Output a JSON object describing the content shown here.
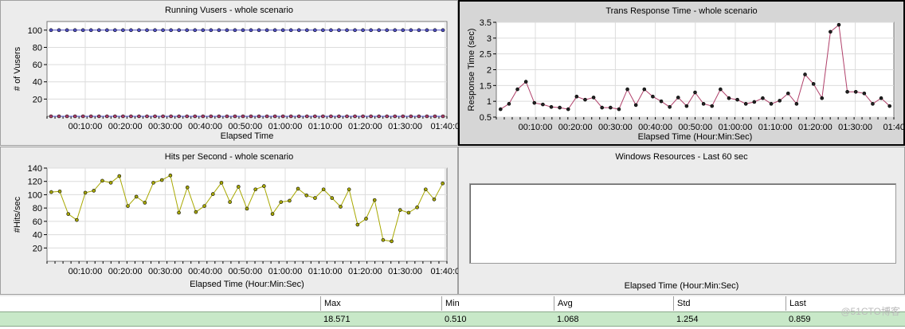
{
  "panels": {
    "vusers": {
      "title": "Running Vusers - whole scenario",
      "xlabel": "Elapsed Time",
      "ylabel": "# of Vusers"
    },
    "trans": {
      "title": "Trans Response Time - whole scenario",
      "xlabel": "Elapsed Time (Hour:Min:Sec)",
      "ylabel": "Response Time (sec)"
    },
    "hits": {
      "title": "Hits per Second - whole scenario",
      "xlabel": "Elapsed Time (Hour:Min:Sec)",
      "ylabel": "#Hits/sec"
    },
    "windows": {
      "title": "Windows Resources - Last 60 sec",
      "xlabel": "Elapsed Time (Hour:Min:Sec)"
    }
  },
  "colors": {
    "vusers": "#5050c8",
    "trans": "#b0406a",
    "hits": "#a8a800",
    "marker_green": "#2e7d32"
  },
  "chart_data": [
    {
      "type": "line",
      "title": "Running Vusers - whole scenario",
      "xlabel": "Elapsed Time",
      "ylabel": "# of Vusers",
      "x_tick_labels": [
        "00:10:00",
        "00:20:00",
        "00:30:00",
        "00:40:00",
        "00:50:00",
        "01:00:00",
        "01:10:00",
        "01:20:00",
        "01:30:00",
        "01:40:0"
      ],
      "y_ticks": [
        20,
        40,
        60,
        80,
        100
      ],
      "ylim": [
        0,
        110
      ],
      "series": [
        {
          "values": [
            100,
            100,
            100,
            100,
            100,
            100,
            100,
            100,
            100,
            100,
            100,
            100,
            100,
            100,
            100,
            100,
            100,
            100,
            100,
            100,
            100,
            100,
            100,
            100,
            100,
            100,
            100,
            100,
            100,
            100,
            100,
            100,
            100,
            100,
            100,
            100,
            100,
            100,
            100,
            100,
            100,
            100,
            100,
            100,
            100,
            100,
            100,
            100,
            100,
            100
          ]
        },
        {
          "values": [
            0,
            0,
            0,
            0,
            0,
            0,
            0,
            0,
            0,
            0,
            0,
            0,
            0,
            0,
            0,
            0,
            0,
            0,
            0,
            0,
            0,
            0,
            0,
            0,
            0,
            0,
            0,
            0,
            0,
            0,
            0,
            0,
            0,
            0,
            0,
            0,
            0,
            0,
            0,
            0,
            0,
            0,
            0,
            0,
            0,
            0,
            0,
            0,
            0,
            0
          ]
        }
      ],
      "grid": true
    },
    {
      "type": "line",
      "title": "Trans Response Time - whole scenario",
      "xlabel": "Elapsed Time (Hour:Min:Sec)",
      "ylabel": "Response Time (sec)",
      "x_tick_labels": [
        "00:10:00",
        "00:20:00",
        "00:30:00",
        "00:40:00",
        "00:50:00",
        "01:00:00",
        "01:10:00",
        "01:20:00",
        "01:30:00",
        "01:40:"
      ],
      "y_ticks": [
        0.5,
        1,
        1.5,
        2,
        2.5,
        3,
        3.5
      ],
      "y_tick_labels": [
        "0.5",
        "1",
        "1.5",
        "2",
        "2.5",
        "3",
        "3.5"
      ],
      "ylim": [
        0.5,
        3.5
      ],
      "series": [
        {
          "values": [
            0.75,
            0.92,
            1.38,
            1.62,
            0.95,
            0.9,
            0.82,
            0.8,
            0.75,
            1.15,
            1.05,
            1.12,
            0.8,
            0.8,
            0.75,
            1.38,
            0.88,
            1.38,
            1.15,
            1.0,
            0.82,
            1.12,
            0.85,
            1.28,
            0.92,
            0.85,
            1.38,
            1.1,
            1.05,
            0.92,
            0.98,
            1.1,
            0.92,
            1.02,
            1.25,
            0.92,
            1.85,
            1.55,
            1.1,
            3.2,
            3.42,
            1.3,
            1.3,
            1.25,
            0.92,
            1.1,
            0.85
          ]
        }
      ],
      "grid": true
    },
    {
      "type": "line",
      "title": "Hits per Second - whole scenario",
      "xlabel": "Elapsed Time (Hour:Min:Sec)",
      "ylabel": "#Hits/sec",
      "x_tick_labels": [
        "00:10:00",
        "00:20:00",
        "00:30:00",
        "00:40:00",
        "00:50:00",
        "01:00:00",
        "01:10:00",
        "01:20:00",
        "01:30:00",
        "01:40:0"
      ],
      "y_ticks": [
        20,
        40,
        60,
        80,
        100,
        120,
        140
      ],
      "ylim": [
        0,
        140
      ],
      "series": [
        {
          "values": [
            104,
            105,
            71,
            62,
            103,
            106,
            121,
            118,
            128,
            83,
            97,
            88,
            118,
            122,
            129,
            73,
            111,
            74,
            83,
            101,
            118,
            89,
            112,
            79,
            108,
            113,
            71,
            89,
            91,
            109,
            99,
            95,
            108,
            95,
            82,
            108,
            55,
            64,
            92,
            32,
            30,
            77,
            73,
            81,
            108,
            93,
            117
          ]
        }
      ],
      "grid": true
    }
  ],
  "stats": {
    "headers": [
      "Max",
      "Min",
      "Avg",
      "Std",
      "Last"
    ],
    "values": [
      "18.571",
      "0.510",
      "1.068",
      "1.254",
      "0.859"
    ]
  },
  "watermark": "@51CTO博客"
}
